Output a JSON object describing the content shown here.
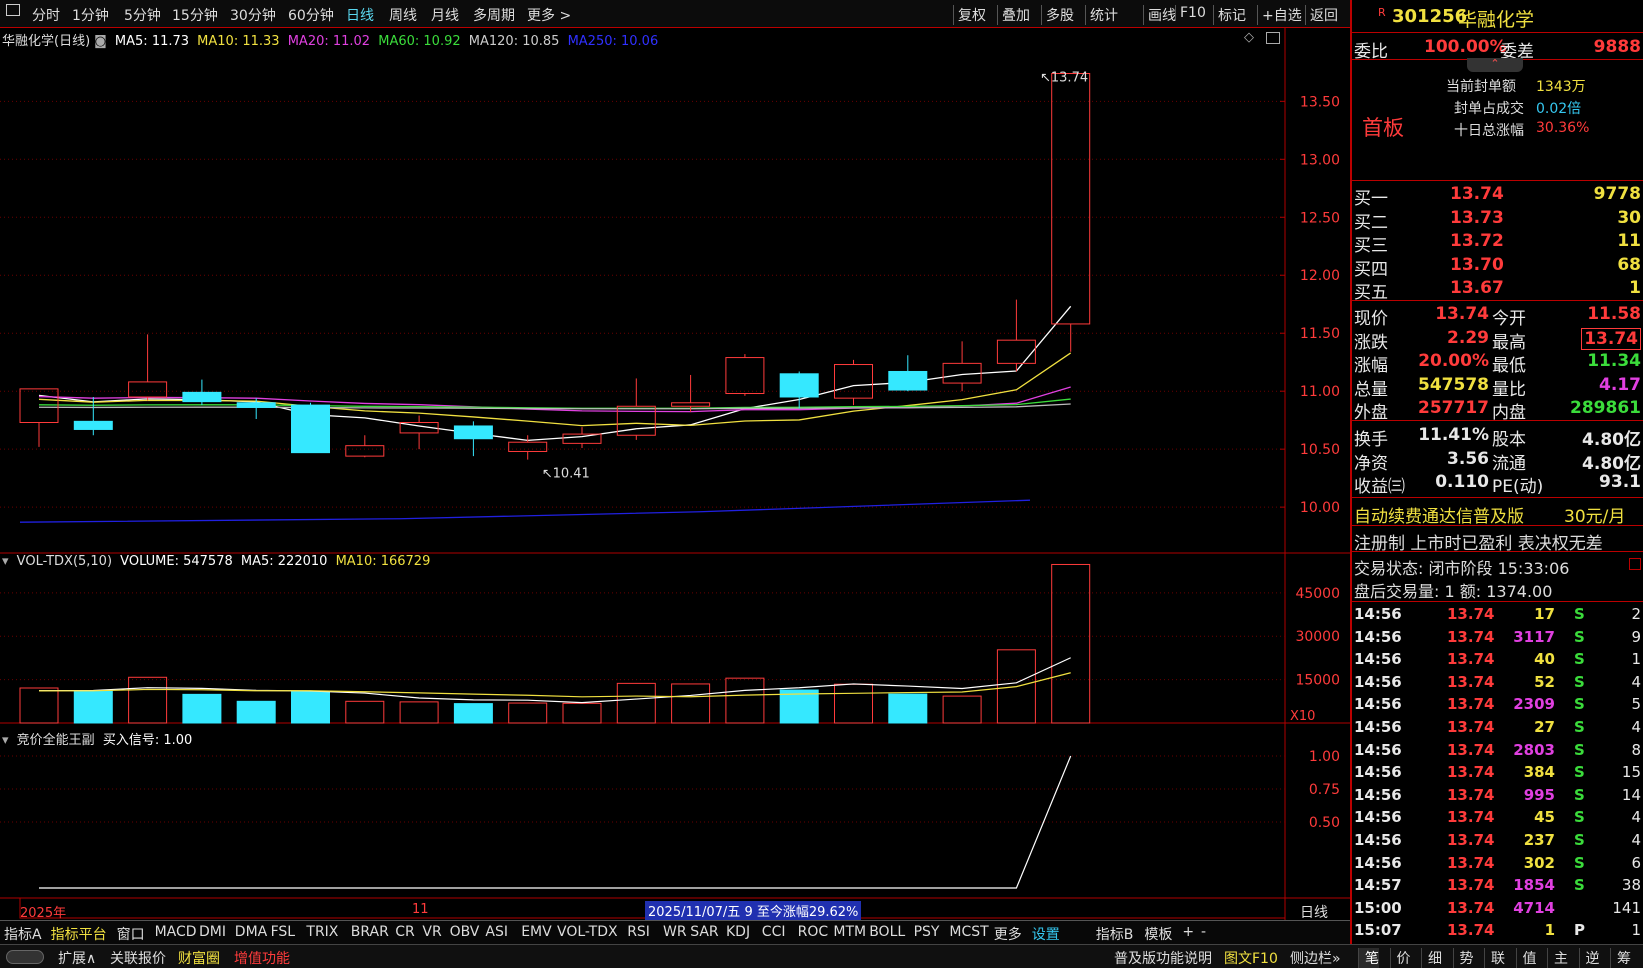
{
  "toolbar": {
    "periods": [
      "分时",
      "1分钟",
      "5分钟",
      "15分钟",
      "30分钟",
      "60分钟",
      "日线",
      "周线",
      "月线",
      "多周期",
      "更多 >"
    ],
    "selected": "日线",
    "right_buttons": [
      "复权",
      "叠加",
      "多股",
      "统计",
      "画线",
      "F10",
      "标记",
      "+自选",
      "返回"
    ]
  },
  "main_legend": {
    "name": "华融化学(日线)",
    "ma5": "MA5: 11.73",
    "ma10": "MA10: 11.33",
    "ma20": "MA20: 11.02",
    "ma60": "MA60: 10.92",
    "ma120": "MA120: 10.85",
    "ma250": "MA250: 10.06"
  },
  "vol_legend": {
    "name": "VOL-TDX(5,10)",
    "volume": "VOLUME: 547578",
    "ma5": "MA5: 222010",
    "ma10": "MA10: 166729"
  },
  "ind_legend": {
    "name": "竞价全能王副",
    "signal": "买入信号: 1.00"
  },
  "price_axis": [
    "13.50",
    "13.00",
    "12.50",
    "12.00",
    "11.50",
    "11.00",
    "10.50",
    "10.00"
  ],
  "vol_axis": [
    "45000",
    "30000",
    "15000"
  ],
  "vol_unit": "X10",
  "ind_axis": [
    "1.00",
    "0.75",
    "0.50"
  ],
  "annotations": {
    "high": "13.74",
    "low": "10.41"
  },
  "time_axis": {
    "year": "2025年",
    "month": "11",
    "info": "2025/11/07/五 9 至今涨幅29.62%",
    "period": "日线"
  },
  "colors": {
    "up": "#ff3b3b",
    "down": "#35e8ff",
    "ma5": "#ffffff",
    "ma10": "#f0e040",
    "ma20": "#e040e0",
    "ma60": "#3bdc3b",
    "ma120": "#bbbbbb",
    "ma250": "#2020e0",
    "frame": "#b00000"
  },
  "chart_data": {
    "type": "candlestick",
    "candles": [
      {
        "o": 10.73,
        "h": 11.02,
        "l": 10.52,
        "c": 11.02
      },
      {
        "o": 10.74,
        "h": 10.95,
        "l": 10.62,
        "c": 10.67
      },
      {
        "o": 10.95,
        "h": 11.49,
        "l": 10.92,
        "c": 11.08
      },
      {
        "o": 10.99,
        "h": 11.1,
        "l": 10.88,
        "c": 10.91
      },
      {
        "o": 10.9,
        "h": 10.94,
        "l": 10.76,
        "c": 10.86
      },
      {
        "o": 10.88,
        "h": 10.9,
        "l": 10.47,
        "c": 10.47
      },
      {
        "o": 10.44,
        "h": 10.62,
        "l": 10.43,
        "c": 10.53
      },
      {
        "o": 10.64,
        "h": 10.79,
        "l": 10.5,
        "c": 10.73
      },
      {
        "o": 10.7,
        "h": 10.74,
        "l": 10.44,
        "c": 10.59
      },
      {
        "o": 10.48,
        "h": 10.62,
        "l": 10.41,
        "c": 10.56
      },
      {
        "o": 10.55,
        "h": 10.69,
        "l": 10.51,
        "c": 10.63
      },
      {
        "o": 10.62,
        "h": 11.11,
        "l": 10.58,
        "c": 10.87
      },
      {
        "o": 10.87,
        "h": 11.14,
        "l": 10.82,
        "c": 10.9
      },
      {
        "o": 10.98,
        "h": 11.32,
        "l": 10.96,
        "c": 11.29
      },
      {
        "o": 11.15,
        "h": 11.17,
        "l": 10.85,
        "c": 10.95
      },
      {
        "o": 10.94,
        "h": 11.27,
        "l": 10.88,
        "c": 11.23
      },
      {
        "o": 11.17,
        "h": 11.31,
        "l": 11.0,
        "c": 11.01
      },
      {
        "o": 11.07,
        "h": 11.43,
        "l": 11.0,
        "c": 11.24
      },
      {
        "o": 11.24,
        "h": 11.79,
        "l": 11.17,
        "c": 11.44
      },
      {
        "o": 11.58,
        "h": 13.74,
        "l": 11.34,
        "c": 13.74
      }
    ],
    "volume": [
      12100,
      11100,
      15800,
      9900,
      7500,
      11000,
      7500,
      7300,
      6700,
      6900,
      6800,
      13700,
      13500,
      15500,
      11400,
      13400,
      10000,
      9300,
      25300,
      54800
    ],
    "ma5_vol_end": 22201,
    "ma10_vol_end": 16673,
    "signal": [
      0,
      0,
      0,
      0,
      0,
      0,
      0,
      0,
      0,
      0,
      0,
      0,
      0,
      0,
      0,
      0,
      0,
      0,
      0,
      1
    ]
  },
  "quote": {
    "code": "301256",
    "name": "华融化学",
    "badge": "R",
    "weibi_label": "委比",
    "weibi": "100.00%",
    "weicha_label": "委差",
    "weicha": "9888",
    "board": "首板",
    "seal_label": "当前封单额",
    "seal": "1343万",
    "seal_ratio_label": "封单占成交",
    "seal_ratio": "0.02倍",
    "ten_day_label": "十日总涨幅",
    "ten_day": "30.36%",
    "bids": [
      {
        "label": "买一",
        "price": "13.74",
        "vol": "9778"
      },
      {
        "label": "买二",
        "price": "13.73",
        "vol": "30"
      },
      {
        "label": "买三",
        "price": "13.72",
        "vol": "11"
      },
      {
        "label": "买四",
        "price": "13.70",
        "vol": "68"
      },
      {
        "label": "买五",
        "price": "13.67",
        "vol": "1"
      }
    ],
    "stats": [
      {
        "l1": "现价",
        "v1": "13.74",
        "l2": "今开",
        "v2": "11.58",
        "c1": "red",
        "c2": "red"
      },
      {
        "l1": "涨跌",
        "v1": "2.29",
        "l2": "最高",
        "v2": "13.74",
        "c1": "red",
        "c2": "red"
      },
      {
        "l1": "涨幅",
        "v1": "20.00%",
        "l2": "最低",
        "v2": "11.34",
        "c1": "red",
        "c2": "grn"
      },
      {
        "l1": "总量",
        "v1": "547578",
        "l2": "量比",
        "v2": "4.17",
        "c1": "yel",
        "c2": "mag"
      },
      {
        "l1": "外盘",
        "v1": "257717",
        "l2": "内盘",
        "v2": "289861",
        "c1": "red",
        "c2": "grn"
      }
    ],
    "fund": [
      {
        "l1": "换手",
        "v1": "11.41%",
        "l2": "股本",
        "v2": "4.80亿"
      },
      {
        "l1": "净资",
        "v1": "3.56",
        "l2": "流通",
        "v2": "4.80亿"
      },
      {
        "l1": "收益㈢",
        "v1": "0.110",
        "l2": "PE(动)",
        "v2": "93.1"
      }
    ],
    "promo": "自动续费通达信普及版",
    "promo_price": "30元/月",
    "reg": "注册制 上市时已盈利 表决权无差",
    "trade_status": "交易状态: 闭市阶段 15:33:06",
    "after_hours": "盘后交易量: 1  额: 1374.00"
  },
  "ticks": [
    {
      "t": "14:56",
      "p": "13.74",
      "v": "17",
      "s": "S",
      "n": "2",
      "c": "yel"
    },
    {
      "t": "14:56",
      "p": "13.74",
      "v": "3117",
      "s": "S",
      "n": "9",
      "c": "mag"
    },
    {
      "t": "14:56",
      "p": "13.74",
      "v": "40",
      "s": "S",
      "n": "1",
      "c": "yel"
    },
    {
      "t": "14:56",
      "p": "13.74",
      "v": "52",
      "s": "S",
      "n": "4",
      "c": "yel"
    },
    {
      "t": "14:56",
      "p": "13.74",
      "v": "2309",
      "s": "S",
      "n": "5",
      "c": "mag"
    },
    {
      "t": "14:56",
      "p": "13.74",
      "v": "27",
      "s": "S",
      "n": "4",
      "c": "yel"
    },
    {
      "t": "14:56",
      "p": "13.74",
      "v": "2803",
      "s": "S",
      "n": "8",
      "c": "mag"
    },
    {
      "t": "14:56",
      "p": "13.74",
      "v": "384",
      "s": "S",
      "n": "15",
      "c": "yel"
    },
    {
      "t": "14:56",
      "p": "13.74",
      "v": "995",
      "s": "S",
      "n": "14",
      "c": "mag"
    },
    {
      "t": "14:56",
      "p": "13.74",
      "v": "45",
      "s": "S",
      "n": "4",
      "c": "yel"
    },
    {
      "t": "14:56",
      "p": "13.74",
      "v": "237",
      "s": "S",
      "n": "4",
      "c": "yel"
    },
    {
      "t": "14:56",
      "p": "13.74",
      "v": "302",
      "s": "S",
      "n": "6",
      "c": "yel"
    },
    {
      "t": "14:57",
      "p": "13.74",
      "v": "1854",
      "s": "S",
      "n": "38",
      "c": "mag"
    },
    {
      "t": "15:00",
      "p": "13.74",
      "v": "4714",
      "s": "",
      "n": "141",
      "c": "mag"
    },
    {
      "t": "15:07",
      "p": "13.74",
      "v": "1",
      "s": "P",
      "n": "1",
      "c": "yel"
    }
  ],
  "bottom_tabs": [
    "指标A",
    "指标平台",
    "窗口",
    "MACD",
    "DMI",
    "DMA",
    "FSL",
    "TRIX",
    "BRAR",
    "CR",
    "VR",
    "OBV",
    "ASI",
    "EMV",
    "VOL-TDX",
    "RSI",
    "WR",
    "SAR",
    "KDJ",
    "CCI",
    "ROC",
    "MTM",
    "BOLL",
    "PSY",
    "MCST",
    "更多",
    "设置",
    "指标B",
    "模板",
    "+",
    "-"
  ],
  "status_left": [
    "扩展∧",
    "关联报价",
    "财富圈",
    "增值功能"
  ],
  "status_right": [
    "普及版功能说明",
    "图文F10",
    "侧边栏»"
  ],
  "side_tabs": [
    "笔",
    "价",
    "细",
    "势",
    "联",
    "值",
    "主",
    "逆",
    "筹"
  ]
}
